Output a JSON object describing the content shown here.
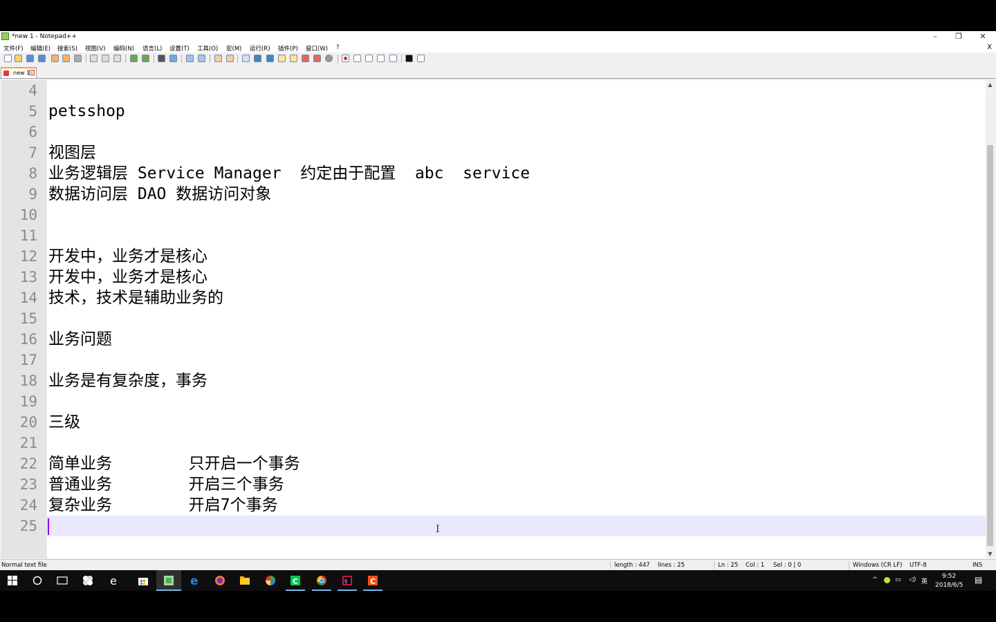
{
  "window": {
    "title": "*new 1 - Notepad++",
    "controls": [
      "–",
      "❐",
      "✕"
    ]
  },
  "menu": {
    "items": [
      "文件(F)",
      "编辑(E)",
      "搜索(S)",
      "视图(V)",
      "编码(N)",
      "语言(L)",
      "设置(T)",
      "工具(O)",
      "宏(M)",
      "运行(R)",
      "插件(P)",
      "窗口(W)",
      "?"
    ],
    "doc_close": "X"
  },
  "tab": {
    "label": "new 1",
    "close": "x"
  },
  "editor": {
    "lines": [
      {
        "num": "4",
        "text": ""
      },
      {
        "num": "5",
        "text": "petsshop"
      },
      {
        "num": "6",
        "text": ""
      },
      {
        "num": "7",
        "text": "视图层"
      },
      {
        "num": "8",
        "text": "业务逻辑层 Service Manager  约定由于配置  abc  service"
      },
      {
        "num": "9",
        "text": "数据访问层 DAO 数据访问对象"
      },
      {
        "num": "10",
        "text": ""
      },
      {
        "num": "11",
        "text": ""
      },
      {
        "num": "12",
        "text": "开发中，业务才是核心"
      },
      {
        "num": "13",
        "text": "开发中，业务才是核心"
      },
      {
        "num": "14",
        "text": "技术，技术是辅助业务的"
      },
      {
        "num": "15",
        "text": ""
      },
      {
        "num": "16",
        "text": "业务问题"
      },
      {
        "num": "17",
        "text": ""
      },
      {
        "num": "18",
        "text": "业务是有复杂度，事务"
      },
      {
        "num": "19",
        "text": ""
      },
      {
        "num": "20",
        "text": "三级"
      },
      {
        "num": "21",
        "text": ""
      },
      {
        "num": "22",
        "text": "简单业务        只开启一个事务"
      },
      {
        "num": "23",
        "text": "普通业务        开启三个事务"
      },
      {
        "num": "24",
        "text": "复杂业务        开启7个事务"
      },
      {
        "num": "25",
        "text": ""
      }
    ],
    "ibeam": "I"
  },
  "statusbar": {
    "file_type": "Normal text file",
    "length": "length : 447",
    "lines": "lines : 25",
    "ln": "Ln : 25",
    "col": "Col : 1",
    "sel": "Sel : 0 | 0",
    "eol": "Windows (CR LF)",
    "encoding": "UTF-8",
    "mode": "INS"
  },
  "taskbar": {
    "tray_lang": "英",
    "time": "9:52",
    "date": "2018/6/5"
  }
}
